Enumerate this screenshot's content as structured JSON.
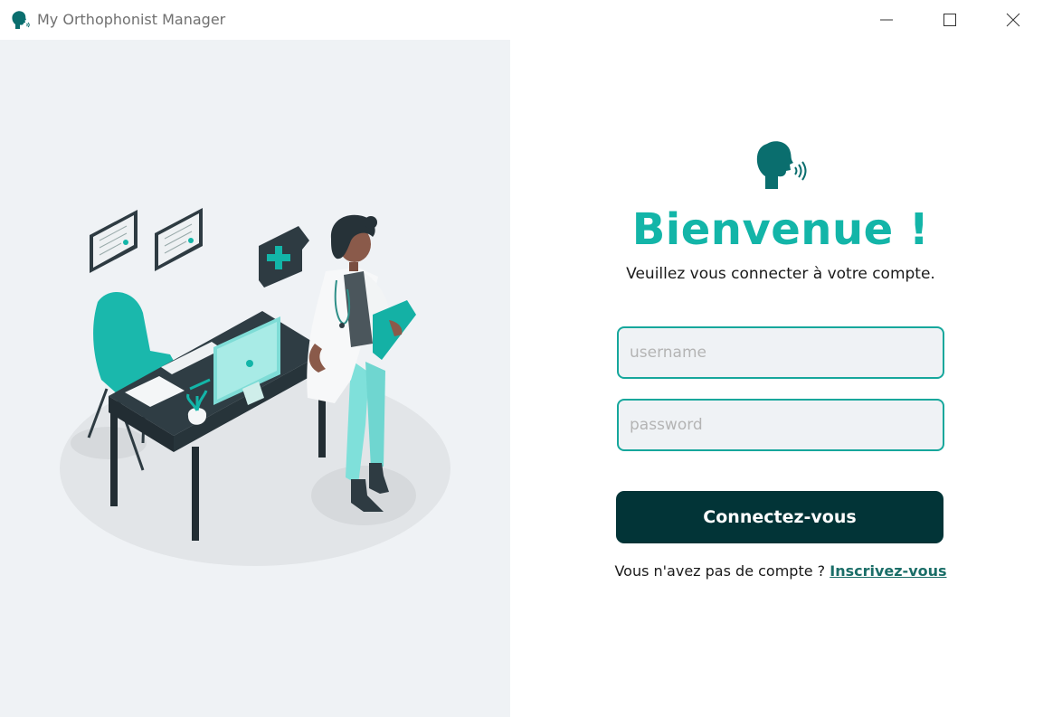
{
  "window": {
    "title": "My Orthophonist Manager",
    "icon": "speaking-head-icon",
    "controls": [
      "minimize-icon",
      "maximize-icon",
      "close-icon"
    ]
  },
  "login": {
    "logo_icon": "speaking-head-icon",
    "heading": "Bienvenue !",
    "subtitle": "Veuillez vous connecter à votre compte.",
    "username_placeholder": "username",
    "username_value": "",
    "password_placeholder": "password",
    "password_value": "",
    "submit_label": "Connectez-vous",
    "signup_prompt": "Vous n'avez pas de compte ? ",
    "signup_link": "Inscrivez-vous"
  },
  "colors": {
    "accent": "#13b5a8",
    "field_border": "#16a79c",
    "button": "#023437",
    "left_panel": "#eff2f5"
  }
}
